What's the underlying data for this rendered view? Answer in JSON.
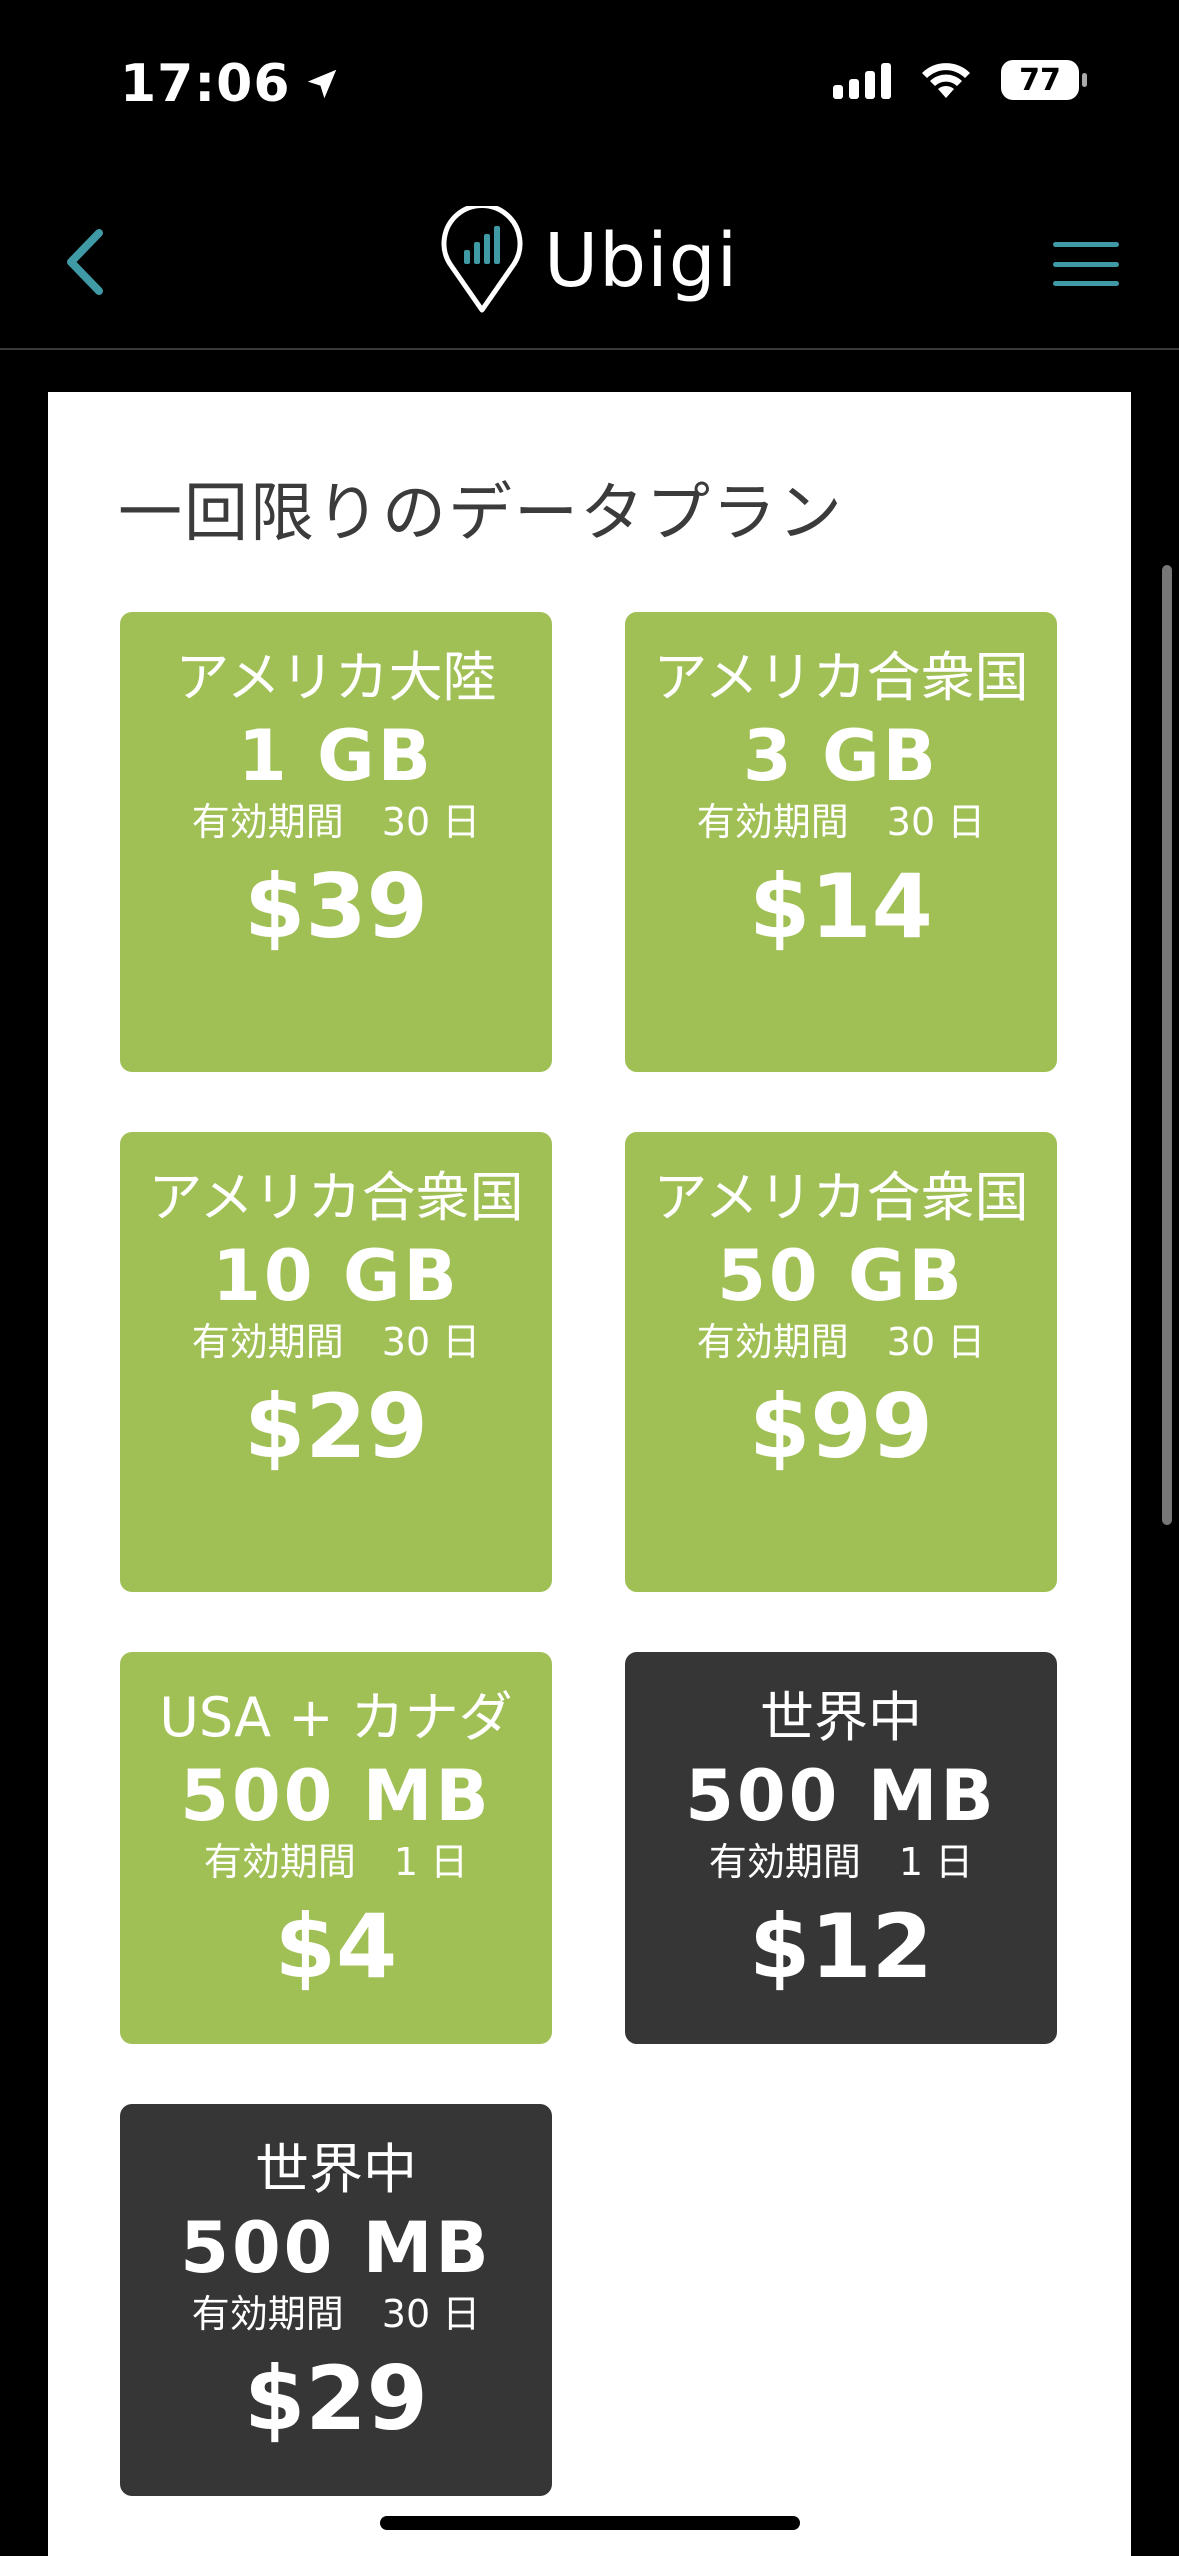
{
  "status_bar": {
    "time": "17:06",
    "battery": "77"
  },
  "header": {
    "logo_text": "Ubigi"
  },
  "page": {
    "title": "一回限りのデータプラン"
  },
  "plans": [
    {
      "region": "アメリカ大陸",
      "size": "1 GB",
      "validity": "有効期間　30 日",
      "price": "$39",
      "style": "green"
    },
    {
      "region": "アメリカ合衆国",
      "size": "3 GB",
      "validity": "有効期間　30 日",
      "price": "$14",
      "style": "green"
    },
    {
      "region": "アメリカ合衆国",
      "size": "10 GB",
      "validity": "有効期間　30 日",
      "price": "$29",
      "style": "green"
    },
    {
      "region": "アメリカ合衆国",
      "size": "50 GB",
      "validity": "有効期間　30 日",
      "price": "$99",
      "style": "green"
    },
    {
      "region": "USA + カナダ",
      "size": "500 MB",
      "validity": "有効期間　1 日",
      "price": "$4",
      "style": "green"
    },
    {
      "region": "世界中",
      "size": "500 MB",
      "validity": "有効期間　1 日",
      "price": "$12",
      "style": "dark"
    },
    {
      "region": "世界中",
      "size": "500 MB",
      "validity": "有効期間　30 日",
      "price": "$29",
      "style": "dark"
    }
  ],
  "colors": {
    "accent": "#3f9aa6",
    "plan_green": "#a0c055",
    "plan_dark": "#363636"
  }
}
